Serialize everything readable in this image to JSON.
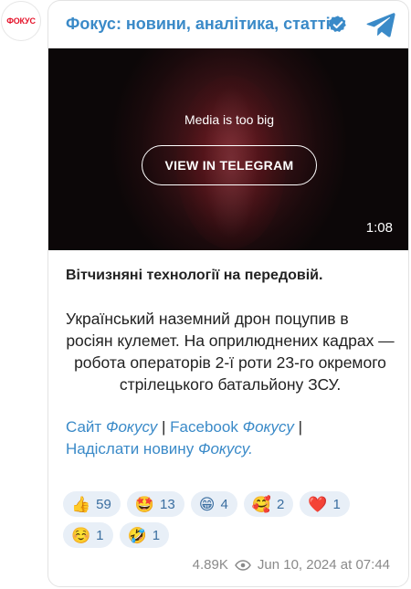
{
  "channel": {
    "avatar_text": "ФОКУС",
    "title": "Фокус: новини, аналітика, статті"
  },
  "media": {
    "message": "Media is too big",
    "button_label": "VIEW IN TELEGRAM",
    "duration": "1:08"
  },
  "post": {
    "headline": "Вітчизняні технології на передовій.",
    "paragraph_line1": "Український наземний дрон поцупив в",
    "paragraph_rest": "росіян кулемет. На оприлюднених кадрах — робота операторів 2-ї роти 23-го окремого стрілецького батальйону ЗСУ.",
    "links": {
      "site": "Сайт",
      "site_brand": "Фокусу",
      "sep1": "|",
      "facebook": "Facebook",
      "facebook_brand": "Фокусу",
      "sep2": "|",
      "submit": "Надіслати новину",
      "submit_brand": "Фокусу."
    }
  },
  "reactions": [
    {
      "emoji": "👍",
      "count": "59"
    },
    {
      "emoji": "🤩",
      "count": "13"
    },
    {
      "emoji": "😁",
      "count": "4"
    },
    {
      "emoji": "🥰",
      "count": "2"
    },
    {
      "emoji": "❤️",
      "count": "1"
    },
    {
      "emoji": "☺️",
      "count": "1"
    },
    {
      "emoji": "🤣",
      "count": "1"
    }
  ],
  "footer": {
    "views": "4.89K",
    "date": "Jun 10, 2024 at 07:44"
  },
  "colors": {
    "accent": "#3a8ac8",
    "brand_red": "#e5132a",
    "reaction_bg": "#e8eff7"
  }
}
